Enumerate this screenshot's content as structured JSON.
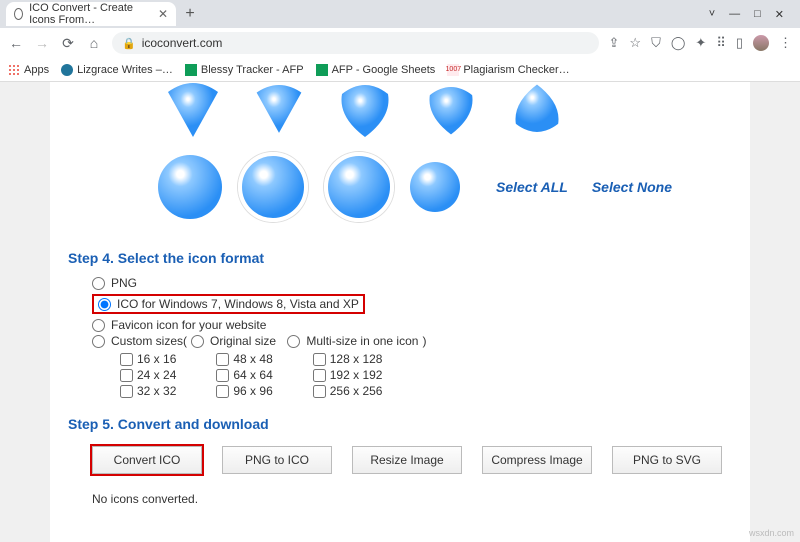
{
  "browser": {
    "tab_title": "ICO Convert - Create Icons From…",
    "url": "icoconvert.com",
    "window_controls": {
      "min": "—",
      "max": "□",
      "close": "✕"
    },
    "ext": {
      "share": "⇪",
      "star": "☆",
      "shield": "⛉",
      "o": "◯",
      "puzzle": "✦",
      "cast": "⠿",
      "box": "▯",
      "menu": "⋮"
    }
  },
  "bookmarks": {
    "apps": "Apps",
    "lizgrace": "Lizgrace Writes –…",
    "blessy": "Blessy Tracker - AFP",
    "afp": "AFP - Google Sheets",
    "plag_badge": "1007",
    "plagiarism": "Plagiarism Checker…"
  },
  "links": {
    "select_all": "Select ALL",
    "select_none": "Select None"
  },
  "step4": {
    "heading": "Step 4. Select the icon format",
    "png": "PNG",
    "ico": "ICO for Windows 7, Windows 8, Vista and XP",
    "favicon": "Favicon icon for your website",
    "custom_prefix": "Custom sizes( ",
    "original": "Original size",
    "multi": "Multi-size in one icon",
    "custom_suffix": " )",
    "sizes": {
      "c1": [
        "16 x 16",
        "24 x 24",
        "32 x 32"
      ],
      "c2": [
        "48 x 48",
        "64 x 64",
        "96 x 96"
      ],
      "c3": [
        "128 x 128",
        "192 x 192",
        "256 x 256"
      ]
    }
  },
  "step5": {
    "heading": "Step 5. Convert and download",
    "buttons": [
      "Convert ICO",
      "PNG to ICO",
      "Resize Image",
      "Compress Image",
      "PNG to SVG"
    ],
    "status": "No icons converted."
  },
  "watermark": "wsxdn.com"
}
